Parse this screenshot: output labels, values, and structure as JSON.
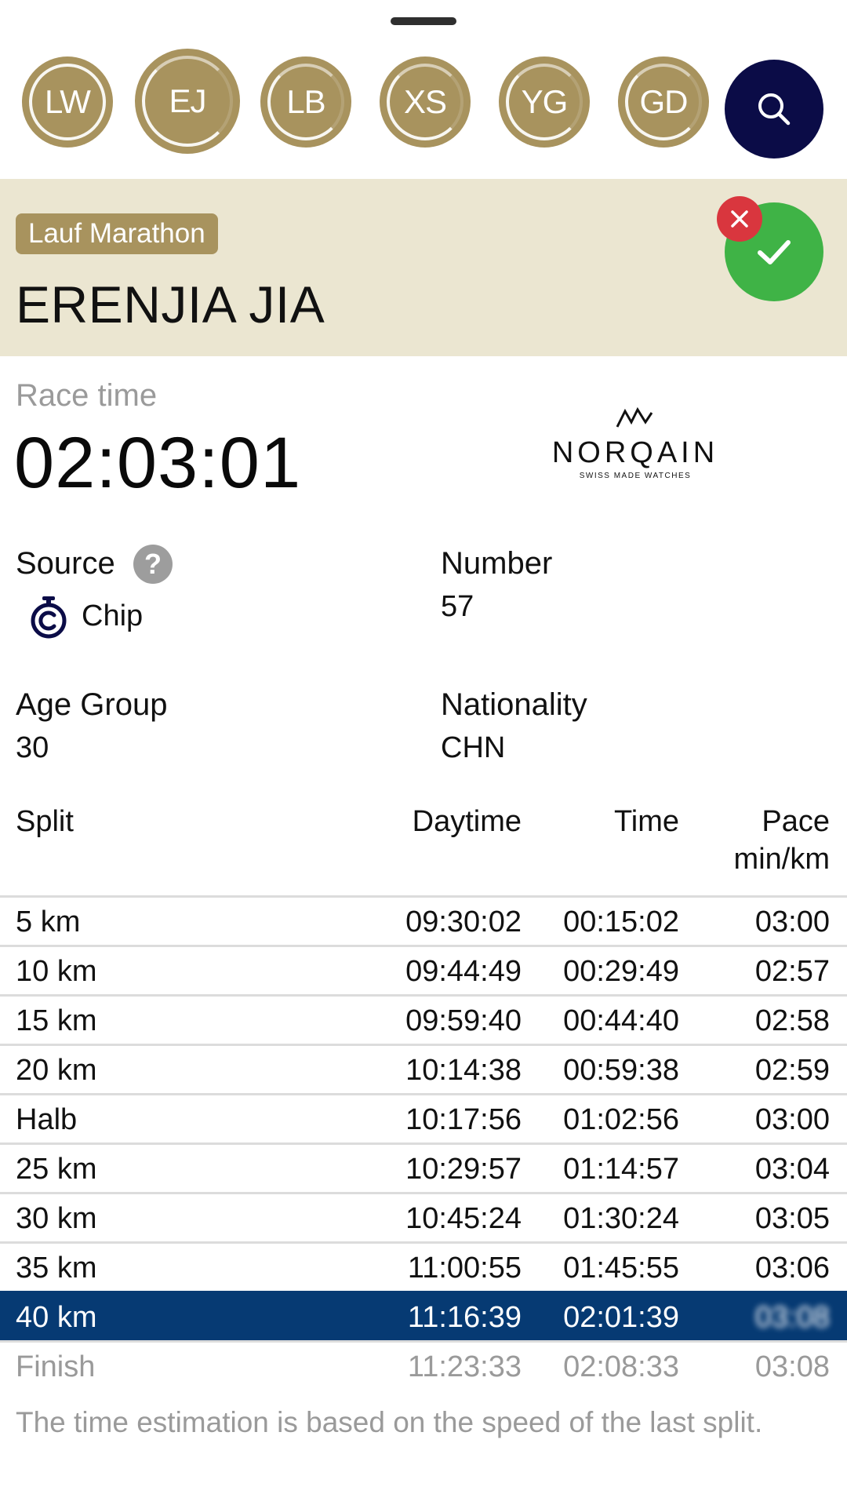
{
  "avatars": [
    {
      "initials": "LW"
    },
    {
      "initials": "EJ"
    },
    {
      "initials": "LB"
    },
    {
      "initials": "XS"
    },
    {
      "initials": "YG"
    },
    {
      "initials": "GD"
    }
  ],
  "colors": {
    "avatar_gold": "#a8935e",
    "search_navy": "#0b0c47",
    "header_beige": "#ebe6d1",
    "confirm_green": "#3fb346",
    "remove_red": "#d9363e",
    "highlight_blue": "#063a73"
  },
  "icons": {
    "search": "search-icon",
    "confirm": "check-icon",
    "remove": "close-icon",
    "help": "question-icon",
    "source": "stopwatch-chip-icon"
  },
  "athlete": {
    "event": "Lauf Marathon",
    "name": "ERENJIA JIA"
  },
  "race": {
    "label": "Race time",
    "time": "02:03:01"
  },
  "sponsor": {
    "brand": "NORQAIN",
    "tagline": "SWISS MADE WATCHES"
  },
  "details": {
    "source_label": "Source",
    "source_value": "Chip",
    "number_label": "Number",
    "number_value": "57",
    "age_group_label": "Age Group",
    "age_group_value": "30",
    "nationality_label": "Nationality",
    "nationality_value": "CHN"
  },
  "table": {
    "headers": {
      "split": "Split",
      "daytime": "Daytime",
      "time": "Time",
      "pace": "Pace",
      "pace_unit": "min/km"
    },
    "rows": [
      {
        "split": "5 km",
        "daytime": "09:30:02",
        "time": "00:15:02",
        "pace": "03:00"
      },
      {
        "split": "10 km",
        "daytime": "09:44:49",
        "time": "00:29:49",
        "pace": "02:57"
      },
      {
        "split": "15 km",
        "daytime": "09:59:40",
        "time": "00:44:40",
        "pace": "02:58"
      },
      {
        "split": "20 km",
        "daytime": "10:14:38",
        "time": "00:59:38",
        "pace": "02:59"
      },
      {
        "split": "Halb",
        "daytime": "10:17:56",
        "time": "01:02:56",
        "pace": "03:00"
      },
      {
        "split": "25 km",
        "daytime": "10:29:57",
        "time": "01:14:57",
        "pace": "03:04"
      },
      {
        "split": "30 km",
        "daytime": "10:45:24",
        "time": "01:30:24",
        "pace": "03:05"
      },
      {
        "split": "35 km",
        "daytime": "11:00:55",
        "time": "01:45:55",
        "pace": "03:06"
      },
      {
        "split": "40 km",
        "daytime": "11:16:39",
        "time": "02:01:39",
        "pace": "03:08"
      },
      {
        "split": "Finish",
        "daytime": "11:23:33",
        "time": "02:08:33",
        "pace": "03:08"
      }
    ]
  },
  "note": "The time estimation is based on the speed of the last split."
}
